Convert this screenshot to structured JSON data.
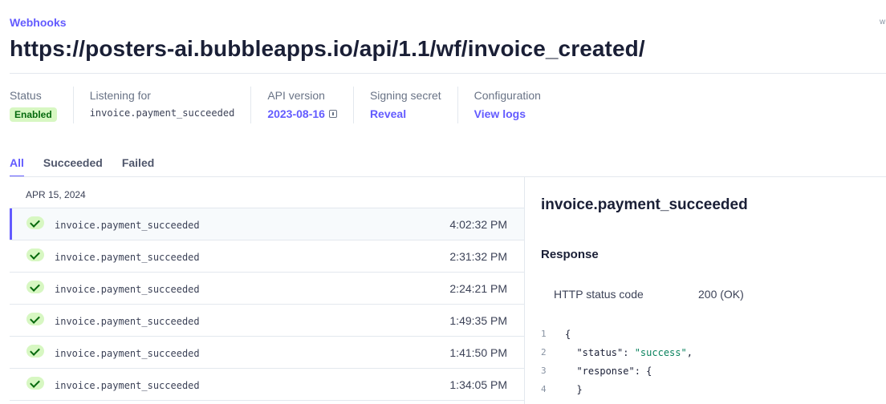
{
  "header": {
    "breadcrumb": "Webhooks",
    "corner_text": "w",
    "title": "https://posters-ai.bubbleapps.io/api/1.1/wf/invoice_created/"
  },
  "meta": {
    "status_label": "Status",
    "status_value": "Enabled",
    "listening_label": "Listening for",
    "listening_value": "invoice.payment_succeeded",
    "api_label": "API version",
    "api_value": "2023-08-16",
    "secret_label": "Signing secret",
    "secret_value": "Reveal",
    "config_label": "Configuration",
    "config_value": "View logs"
  },
  "tabs": [
    {
      "label": "All",
      "active": true
    },
    {
      "label": "Succeeded",
      "active": false
    },
    {
      "label": "Failed",
      "active": false
    }
  ],
  "events": {
    "date": "APR 15, 2024",
    "rows": [
      {
        "name": "invoice.payment_succeeded",
        "time": "4:02:32 PM",
        "selected": true,
        "icon": "check-icon"
      },
      {
        "name": "invoice.payment_succeeded",
        "time": "2:31:32 PM",
        "selected": false,
        "icon": "check-icon"
      },
      {
        "name": "invoice.payment_succeeded",
        "time": "2:24:21 PM",
        "selected": false,
        "icon": "check-icon"
      },
      {
        "name": "invoice.payment_succeeded",
        "time": "1:49:35 PM",
        "selected": false,
        "icon": "check-icon"
      },
      {
        "name": "invoice.payment_succeeded",
        "time": "1:41:50 PM",
        "selected": false,
        "icon": "check-icon"
      },
      {
        "name": "invoice.payment_succeeded",
        "time": "1:34:05 PM",
        "selected": false,
        "icon": "check-icon"
      }
    ]
  },
  "detail": {
    "title": "invoice.payment_succeeded",
    "response_heading": "Response",
    "http_status_label": "HTTP status code",
    "http_status_value": "200 (OK)",
    "code_lines": [
      {
        "num": "1",
        "text": "{"
      },
      {
        "num": "2",
        "key": "  \"status\": ",
        "str": "\"success\"",
        "tail": ","
      },
      {
        "num": "3",
        "text": "  \"response\": {"
      },
      {
        "num": "4",
        "text": "  }"
      }
    ]
  },
  "colors": {
    "accent": "#635bff",
    "success_bg": "#d7f7c2",
    "success_fg": "#05690d"
  }
}
